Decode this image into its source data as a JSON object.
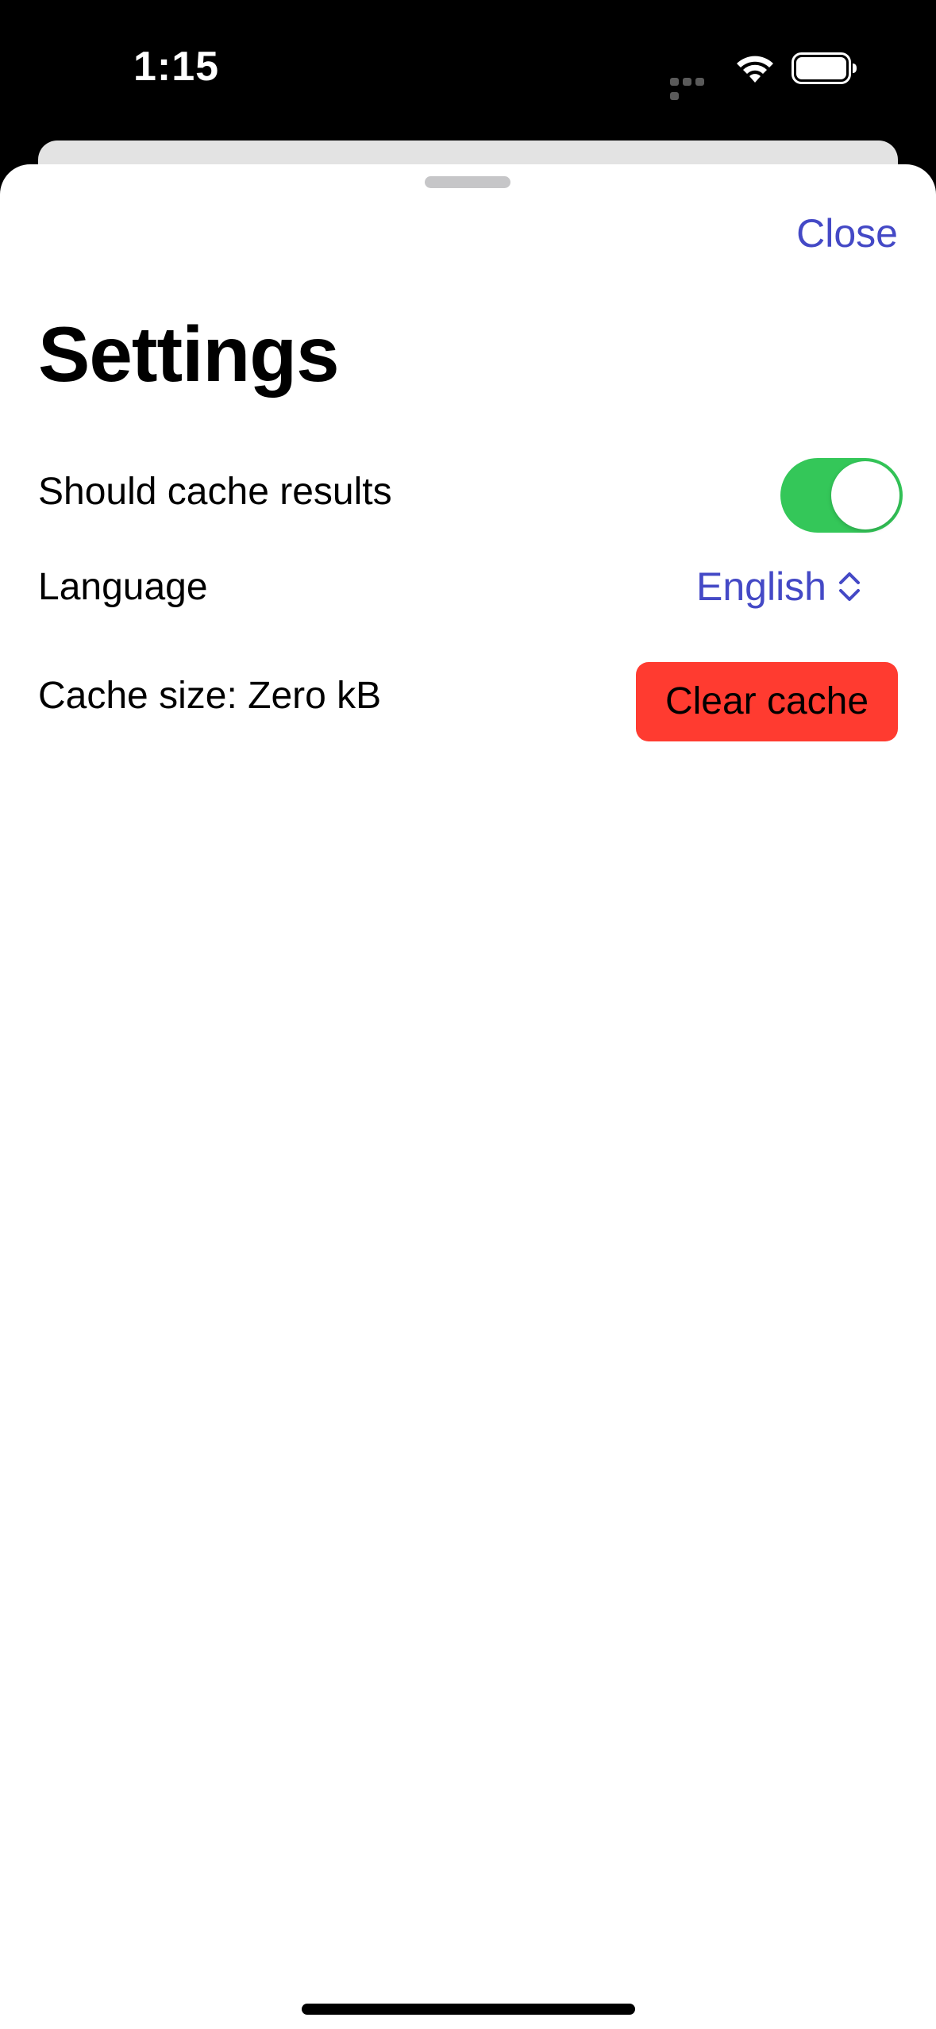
{
  "status_bar": {
    "time": "1:15",
    "icons": [
      "cellular-dots-icon",
      "wifi-icon",
      "battery-icon"
    ]
  },
  "sheet": {
    "close_label": "Close",
    "title": "Settings"
  },
  "settings": {
    "cache_results_label": "Should cache results",
    "cache_results_enabled": true,
    "language_label": "Language",
    "language_value": "English",
    "cache_size_label": "Cache size: Zero kB",
    "clear_cache_label": "Clear cache"
  },
  "colors": {
    "accent": "#4449c6",
    "toggle_on": "#34c759",
    "destructive": "#ff3b30",
    "sheet_bg": "#ffffff",
    "status_bg": "#000000"
  }
}
